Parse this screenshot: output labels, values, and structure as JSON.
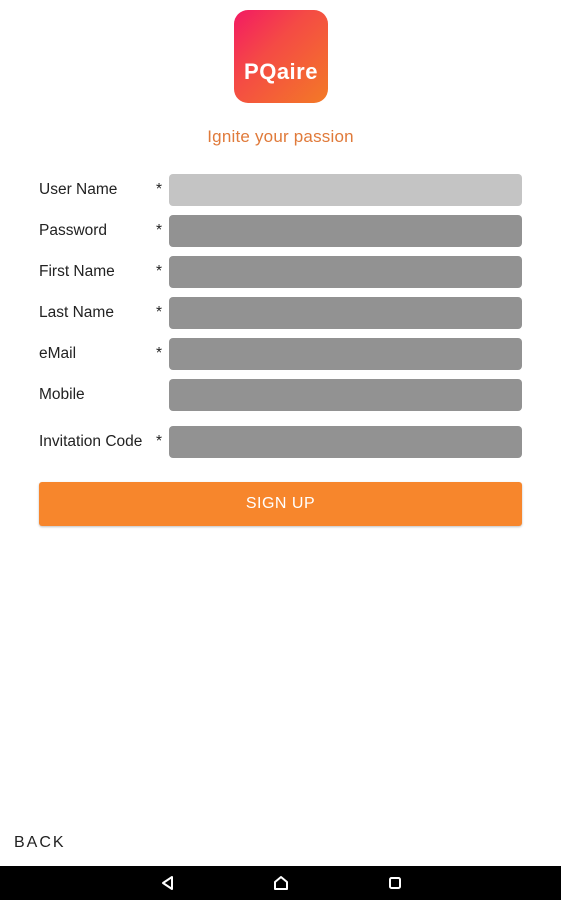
{
  "logo": {
    "text": "PQaire"
  },
  "tagline": "Ignite your passion",
  "form": {
    "fields": [
      {
        "label": "User Name",
        "required_mark": "*",
        "value": ""
      },
      {
        "label": "Password",
        "required_mark": "*",
        "value": ""
      },
      {
        "label": "First Name",
        "required_mark": "*",
        "value": ""
      },
      {
        "label": "Last Name",
        "required_mark": "*",
        "value": ""
      },
      {
        "label": "eMail",
        "required_mark": "*",
        "value": ""
      },
      {
        "label": "Mobile",
        "required_mark": "",
        "value": ""
      },
      {
        "label": "Invitation Code",
        "required_mark": "*",
        "value": ""
      }
    ],
    "signup_label": "SIGN UP"
  },
  "back_label": "BACK",
  "colors": {
    "accent": "#f7862c",
    "tagline": "#e07a3a",
    "field_active": "#c4c4c4",
    "field_inactive": "#929292",
    "logo_gradient_start": "#f31a63",
    "logo_gradient_end": "#f37a26"
  },
  "navbar": {
    "icons": [
      "back-triangle-icon",
      "home-circle-icon",
      "recents-square-icon"
    ]
  }
}
